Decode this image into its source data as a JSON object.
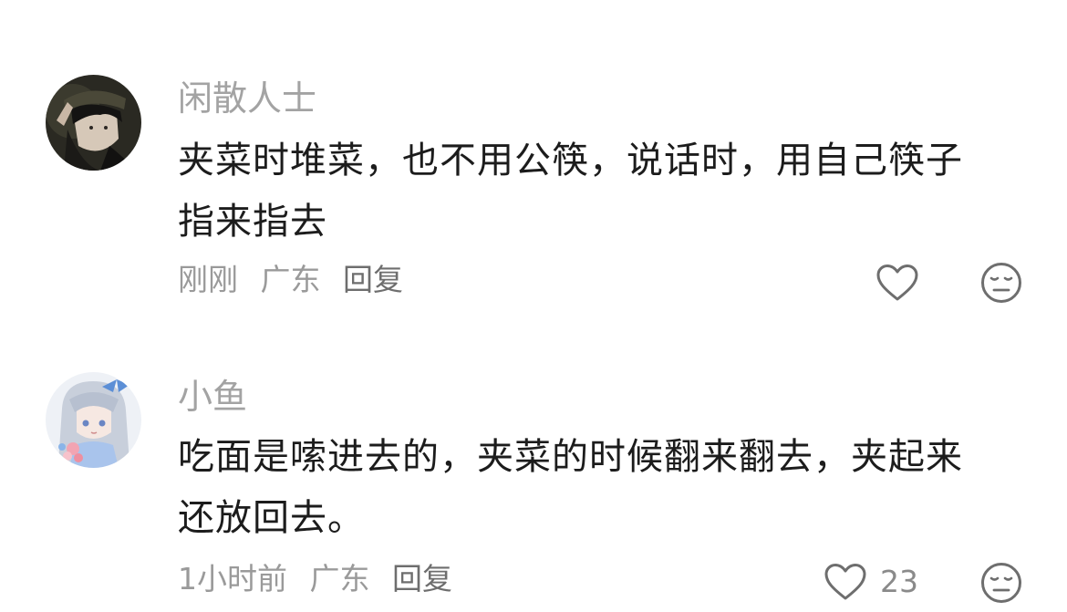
{
  "comments": [
    {
      "username": "闲散人士",
      "text_line1": "夹菜时堆菜，也不用公筷，说话时，用自己筷子",
      "text_line2": "指来指去",
      "time": "刚刚",
      "location": "广东",
      "reply_label": "回复",
      "like_count": "",
      "avatar_icon": "dark-hat-person-avatar",
      "like_icon": "heart-outline-icon",
      "dislike_icon": "neutral-face-icon"
    },
    {
      "username": "小鱼",
      "text_line1": "吃面是嗦进去的，夹菜的时候翻来翻去，夹起来",
      "text_line2": "还放回去。",
      "time": "1小时前",
      "location": "广东",
      "reply_label": "回复",
      "like_count": "23",
      "avatar_icon": "anime-girl-blue-bow-avatar",
      "like_icon": "heart-outline-icon",
      "dislike_icon": "neutral-face-icon"
    }
  ],
  "colors": {
    "username": "#a3a3a3",
    "text": "#1c1c1c",
    "meta": "#9a9a9a",
    "icon": "#6e6e6e"
  }
}
